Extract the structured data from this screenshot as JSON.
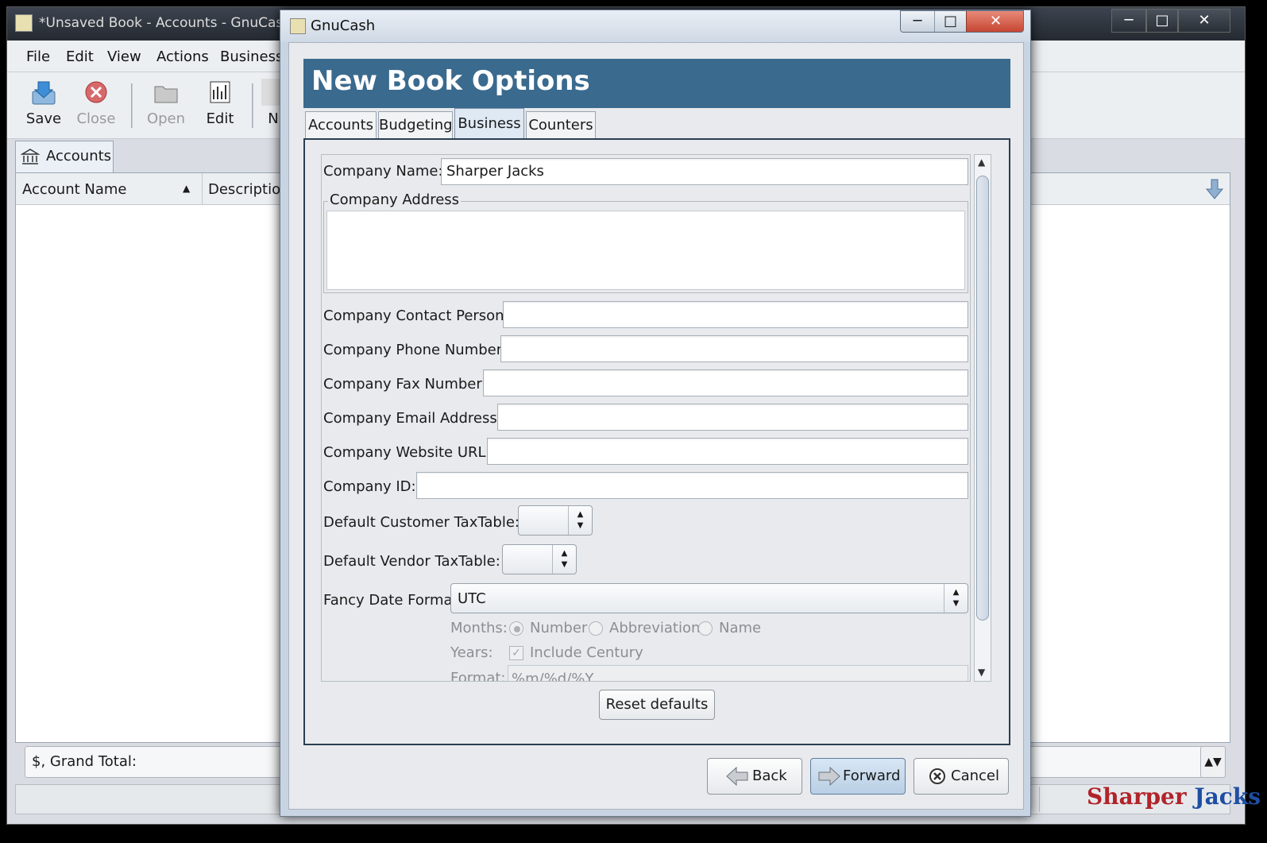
{
  "main_window": {
    "title": "*Unsaved Book - Accounts - GnuCash",
    "menu": [
      "File",
      "Edit",
      "View",
      "Actions",
      "Business"
    ],
    "toolbar": {
      "save": "Save",
      "close": "Close",
      "open": "Open",
      "edit": "Edit",
      "new_partial": "N"
    },
    "tab": "Accounts",
    "columns": {
      "account_name": "Account Name",
      "description": "Description"
    },
    "grand_total": "$, Grand Total:"
  },
  "dialog": {
    "title": "GnuCash",
    "banner": "New Book Options",
    "tabs": [
      "Accounts",
      "Budgeting",
      "Business",
      "Counters"
    ],
    "active_tab": "Business",
    "fields": {
      "company_name_label": "Company Name:",
      "company_name_value": "Sharper Jacks",
      "company_address_label": "Company Address",
      "contact_label": "Company Contact Person:",
      "phone_label": "Company Phone Number:",
      "fax_label": "Company Fax Number:",
      "email_label": "Company Email Address:",
      "website_label": "Company Website URL:",
      "id_label": "Company ID:",
      "customer_tax_label": "Default Customer TaxTable:",
      "vendor_tax_label": "Default Vendor TaxTable:",
      "date_format_label": "Fancy Date Format",
      "date_format_value": "UTC",
      "months_label": "Months:",
      "month_opts": [
        "Number",
        "Abbreviation",
        "Name"
      ],
      "years_label": "Years:",
      "include_century": "Include Century",
      "format_label": "Format:",
      "format_value": "%m/%d/%Y"
    },
    "reset_defaults": "Reset defaults",
    "buttons": {
      "back": "Back",
      "forward": "Forward",
      "cancel": "Cancel"
    }
  },
  "watermark": {
    "part1": "Sharper ",
    "part2": "Jacks",
    "color1": "#b0242a",
    "color2": "#1f4ea3"
  },
  "colors": {
    "banner": "#3a6a8e"
  }
}
